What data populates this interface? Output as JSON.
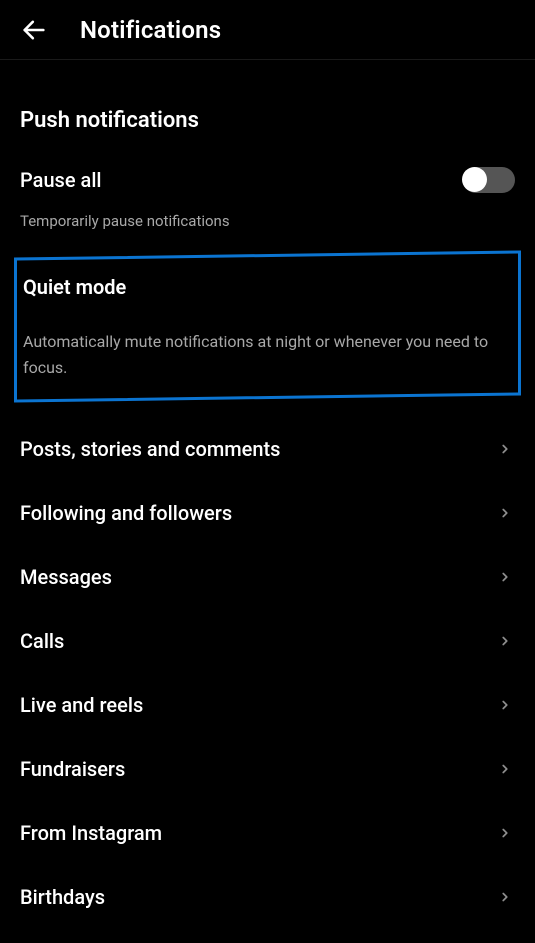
{
  "header": {
    "title": "Notifications"
  },
  "section": {
    "title": "Push notifications"
  },
  "pause_all": {
    "title": "Pause all",
    "subtitle": "Temporarily pause notifications",
    "toggled": false
  },
  "quiet_mode": {
    "title": "Quiet mode",
    "subtitle": "Automatically mute notifications at night or whenever you need to focus."
  },
  "items": [
    {
      "label": "Posts, stories and comments"
    },
    {
      "label": "Following and followers"
    },
    {
      "label": "Messages"
    },
    {
      "label": "Calls"
    },
    {
      "label": "Live and reels"
    },
    {
      "label": "Fundraisers"
    },
    {
      "label": "From Instagram"
    },
    {
      "label": "Birthdays"
    }
  ]
}
